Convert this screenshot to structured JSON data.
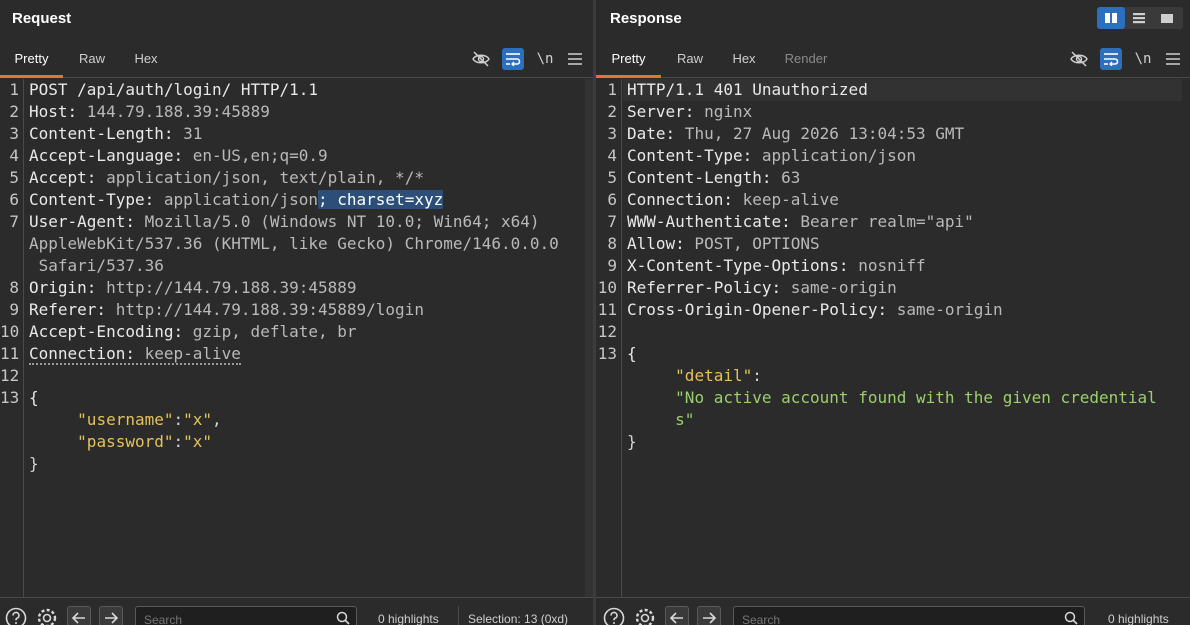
{
  "request": {
    "title": "Request",
    "tabs": [
      "Pretty",
      "Raw",
      "Hex"
    ],
    "active_tab": "Pretty",
    "newline_label": "\\n",
    "lines": [
      {
        "n": "1",
        "key": "POST /api/auth/login/ HTTP/1.1",
        "val": ""
      },
      {
        "n": "2",
        "key": "Host:",
        "val": " 144.79.188.39:45889"
      },
      {
        "n": "3",
        "key": "Content-Length:",
        "val": " 31"
      },
      {
        "n": "4",
        "key": "Accept-Language:",
        "val": " en-US,en;q=0.9"
      },
      {
        "n": "5",
        "key": "Accept:",
        "val": " application/json, text/plain, */*"
      },
      {
        "n": "6",
        "key": "Content-Type:",
        "val": " application/json",
        "selected": "; charset=xyz"
      },
      {
        "n": "7",
        "key": "User-Agent:",
        "val": " Mozilla/5.0 (Windows NT 10.0; Win64; x64)"
      },
      {
        "n": "",
        "key": "",
        "val": "AppleWebKit/537.36 (KHTML, like Gecko) Chrome/146.0.0.0"
      },
      {
        "n": "",
        "key": "",
        "val": " Safari/537.36"
      },
      {
        "n": "8",
        "key": "Origin:",
        "val": " http://144.79.188.39:45889"
      },
      {
        "n": "9",
        "key": "Referer:",
        "val": " http://144.79.188.39:45889/login"
      },
      {
        "n": "10",
        "key": "Accept-Encoding:",
        "val": " gzip, deflate, br"
      },
      {
        "n": "11",
        "key": "Connection:",
        "val": " keep-alive"
      },
      {
        "n": "12",
        "key": "",
        "val": ""
      },
      {
        "n": "13",
        "key": "{",
        "val": ""
      }
    ],
    "body": {
      "username_key": "\"username\"",
      "username_val": "\"x\"",
      "password_key": "\"password\"",
      "password_val": "\"x\"",
      "close": "}"
    },
    "footer": {
      "search_placeholder": "Search",
      "highlights": "0 highlights",
      "selection": "Selection: 13 (0xd)"
    }
  },
  "response": {
    "title": "Response",
    "tabs": [
      "Pretty",
      "Raw",
      "Hex",
      "Render"
    ],
    "active_tab": "Pretty",
    "newline_label": "\\n",
    "lines": [
      {
        "n": "1",
        "key": "HTTP/1.1 401 Unauthorized",
        "val": ""
      },
      {
        "n": "2",
        "key": "Server:",
        "val": " nginx"
      },
      {
        "n": "3",
        "key": "Date:",
        "val": " Thu, 27 Aug 2026 13:04:53 GMT"
      },
      {
        "n": "4",
        "key": "Content-Type:",
        "val": " application/json"
      },
      {
        "n": "5",
        "key": "Content-Length:",
        "val": " 63"
      },
      {
        "n": "6",
        "key": "Connection:",
        "val": " keep-alive"
      },
      {
        "n": "7",
        "key": "WWW-Authenticate:",
        "val": " Bearer realm=\"api\""
      },
      {
        "n": "8",
        "key": "Allow:",
        "val": " POST, OPTIONS"
      },
      {
        "n": "9",
        "key": "X-Content-Type-Options:",
        "val": " nosniff"
      },
      {
        "n": "10",
        "key": "Referrer-Policy:",
        "val": " same-origin"
      },
      {
        "n": "11",
        "key": "Cross-Origin-Opener-Policy:",
        "val": " same-origin"
      },
      {
        "n": "12",
        "key": "",
        "val": ""
      },
      {
        "n": "13",
        "key": "{",
        "val": ""
      }
    ],
    "body": {
      "detail_key": "\"detail\"",
      "detail_val_1": "\"No active account found with the given credential",
      "detail_val_2": "s\"",
      "close": "}"
    },
    "footer": {
      "search_placeholder": "Search",
      "highlights": "0 highlights"
    }
  },
  "colors": {
    "accent": "#e8703a",
    "toggle_blue": "#2d6fbf",
    "selection": "#2b4f78"
  }
}
